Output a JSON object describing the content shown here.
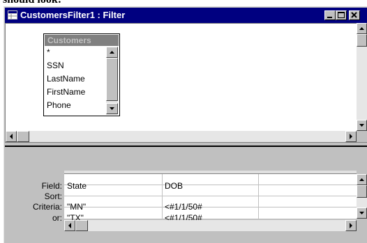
{
  "caption_fragment": "should look:",
  "window": {
    "title": "CustomersFilter1 : Filter",
    "icon": "filter-window-icon",
    "buttons": [
      "minimize-icon",
      "maximize-icon",
      "close-icon"
    ]
  },
  "field_list": {
    "table_name": "Customers",
    "fields": [
      "*",
      "SSN",
      "LastName",
      "FirstName",
      "Phone"
    ]
  },
  "grid": {
    "row_labels": {
      "field": "Field:",
      "sort": "Sort:",
      "criteria": "Criteria:",
      "or": "or:"
    },
    "columns": [
      {
        "field": "State",
        "sort": "",
        "criteria": "\"MN\"",
        "or": "\"TX\""
      },
      {
        "field": "DOB",
        "sort": "",
        "criteria": "<#1/1/50#",
        "or": "<#1/1/50#"
      },
      {
        "field": "",
        "sort": "",
        "criteria": "",
        "or": ""
      }
    ]
  }
}
